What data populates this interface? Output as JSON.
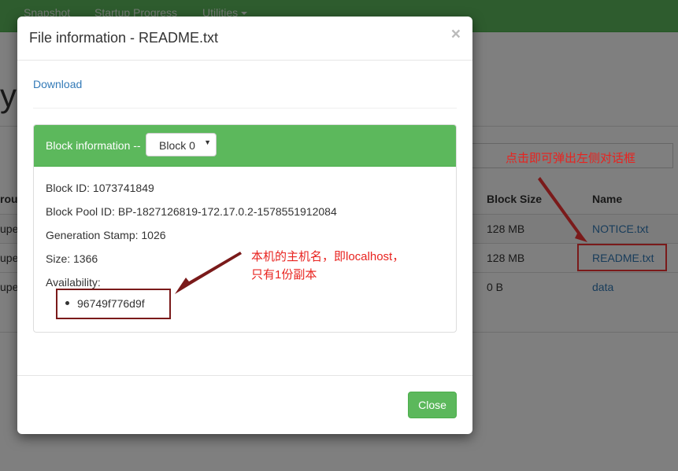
{
  "background": {
    "nav_items": [
      "Snapshot",
      "Startup Progress",
      "Utilities"
    ],
    "heading_partial": "ry",
    "table_headers": {
      "group_partial": "rou",
      "block_size": "Block Size",
      "name": "Name"
    },
    "rows": [
      {
        "group_partial": "upe",
        "block_size": "128 MB",
        "name": "NOTICE.txt"
      },
      {
        "group_partial": "upe",
        "block_size": "128 MB",
        "name": "README.txt"
      },
      {
        "group_partial": "upe",
        "block_size": "0 B",
        "name": "data"
      }
    ]
  },
  "modal": {
    "title": "File information - README.txt",
    "close_icon": "×",
    "download_label": "Download",
    "panel_label": "Block information --",
    "block_select_value": "Block 0",
    "block_select_caret": "▼",
    "block_id": "Block ID: 1073741849",
    "block_pool_id": "Block Pool ID: BP-1827126819-172.17.0.2-1578551912084",
    "generation_stamp": "Generation Stamp: 1026",
    "size": "Size: 1366",
    "availability_label": "Availability:",
    "availability_hosts": [
      "96749f776d9f"
    ],
    "close_button": "Close"
  },
  "annotations": {
    "top_right": "点击即可弹出左侧对话框",
    "middle_line1": "本机的主机名，即localhost，",
    "middle_line2": "只有1份副本"
  },
  "colors": {
    "accent_green": "#5cb85c",
    "link_blue": "#337ab7",
    "annotation_red": "#e8231f",
    "annotation_box": "#7a1a1a"
  }
}
